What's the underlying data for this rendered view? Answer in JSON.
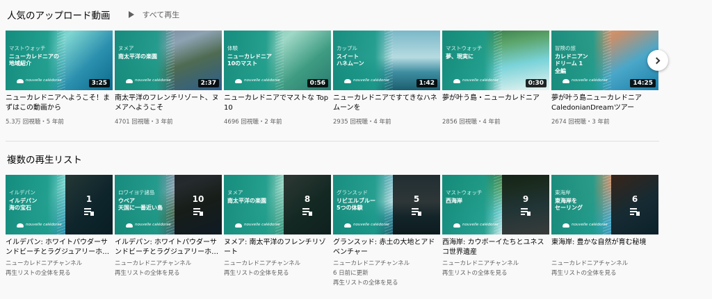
{
  "popular": {
    "title": "人気のアップロード動画",
    "play_all": "すべて再生",
    "videos": [
      {
        "category": "マストウォッチ",
        "thumb_title": "ニューカレドニアの\n地域紹介",
        "duration": "3:25",
        "title": "ニューカレドニアへようこそ！まずはこの動画から",
        "meta": "5.3万 回視聴・5 年前"
      },
      {
        "category": "ヌメア",
        "thumb_title": "南太平洋の楽園",
        "duration": "2:37",
        "title": "南太平洋のフレンチリゾート、ヌメアへようこそ",
        "meta": "4701 回視聴・3 年前"
      },
      {
        "category": "体験",
        "thumb_title": "ニューカレドニア\n10のマスト",
        "duration": "0:56",
        "title": "ニューカレドニアでマストな Top 10",
        "meta": "4696 回視聴・2 年前"
      },
      {
        "category": "カップル",
        "thumb_title": "スイート\nハネムーン",
        "duration": "1:42",
        "title": "ニューカレドニアですてきなハネムーンを",
        "meta": "2935 回視聴・4 年前"
      },
      {
        "category": "マストウォッチ",
        "thumb_title": "夢、現実に",
        "duration": "0:30",
        "title": "夢が叶う島・ニューカレドニア",
        "meta": "2856 回視聴・4 年前"
      },
      {
        "category": "冒険の旅",
        "thumb_title": "カレドニアン\nドリーム 1\n全編",
        "duration": "14:25",
        "title": "夢が叶う島ニューカレドニア CaledonianDreamツアー",
        "meta": "2674 回視聴・3 年前"
      }
    ],
    "logo_text": "nouvelle calédonie"
  },
  "playlists": {
    "title": "複数の再生リスト",
    "items": [
      {
        "category": "イルデパン",
        "thumb_title": "イルデパン\n海の宝石",
        "count": "1",
        "title": "イルデパン: ホワイトパウダーサンドビーチとラグジュアリーホ…",
        "channel": "ニューカレドニアチャンネル",
        "updated": "",
        "link": "再生リストの全体を見る"
      },
      {
        "category": "ロワイヨテ諸島",
        "thumb_title": "ウベア\n天国に一番近い島",
        "count": "10",
        "title": "イルデパン: ホワイトパウダーサンドビーチとラグジュアリーホ…",
        "channel": "ニューカレドニアチャンネル",
        "updated": "",
        "link": "再生リストの全体を見る"
      },
      {
        "category": "ヌメア",
        "thumb_title": "南太平洋の楽園",
        "count": "8",
        "title": "ヌメア: 南太平洋のフレンチリゾート",
        "channel": "ニューカレドニアチャンネル",
        "updated": "",
        "link": "再生リストの全体を見る"
      },
      {
        "category": "グランスッド",
        "thumb_title": "リビエルブルー\n5つの体験",
        "count": "5",
        "title": "グランスッド: 赤土の大地とアドベンチャー",
        "channel": "ニューカレドニアチャンネル",
        "updated": "6 日前に更新",
        "link": "再生リストの全体を見る"
      },
      {
        "category": "マストウォッチ",
        "thumb_title": "西海岸",
        "count": "9",
        "title": "西海岸: カウボーイたちとユネスコ世界遺産",
        "channel": "ニューカレドニアチャンネル",
        "updated": "",
        "link": "再生リストの全体を見る"
      },
      {
        "category": "東海岸",
        "thumb_title": "東海岸を\nセーリング",
        "count": "6",
        "title": "東海岸: 豊かな自然が育む秘境",
        "channel": "ニューカレドニアチャンネル",
        "updated": "",
        "link": "再生リストの全体を見る"
      }
    ]
  },
  "colors": {
    "accent_teal": "#1c9b8a",
    "text_primary": "#030303",
    "text_secondary": "#606060"
  },
  "icons": {
    "next": "chevron-right-icon",
    "play_all": "play-icon",
    "playlist": "playlist-play-icon"
  }
}
